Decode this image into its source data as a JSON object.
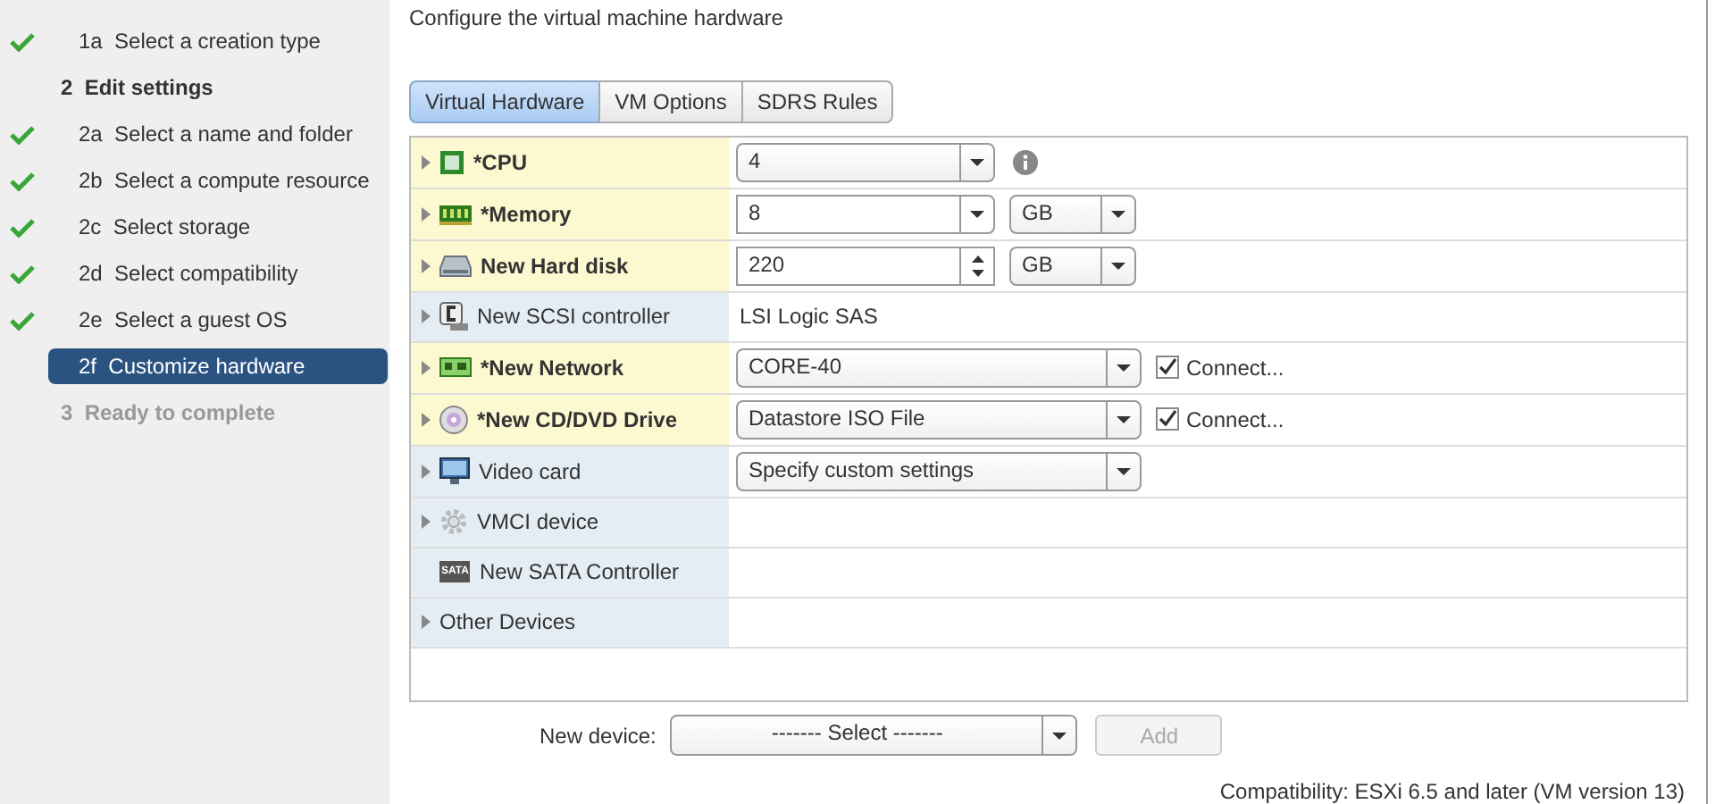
{
  "steps": [
    {
      "number": "1a",
      "label": "Select a creation type",
      "kind": "substep",
      "done": true,
      "selected": false,
      "disabled": false
    },
    {
      "number": "2",
      "label": "Edit settings",
      "kind": "group",
      "done": false,
      "selected": false,
      "disabled": false
    },
    {
      "number": "2a",
      "label": "Select a name and folder",
      "kind": "substep",
      "done": true,
      "selected": false,
      "disabled": false
    },
    {
      "number": "2b",
      "label": "Select a compute resource",
      "kind": "substep",
      "done": true,
      "selected": false,
      "disabled": false
    },
    {
      "number": "2c",
      "label": "Select storage",
      "kind": "substep",
      "done": true,
      "selected": false,
      "disabled": false
    },
    {
      "number": "2d",
      "label": "Select compatibility",
      "kind": "substep",
      "done": true,
      "selected": false,
      "disabled": false
    },
    {
      "number": "2e",
      "label": "Select a guest OS",
      "kind": "substep",
      "done": true,
      "selected": false,
      "disabled": false
    },
    {
      "number": "2f",
      "label": "Customize hardware",
      "kind": "substep",
      "done": false,
      "selected": true,
      "disabled": false
    },
    {
      "number": "3",
      "label": "Ready to complete",
      "kind": "group",
      "done": false,
      "selected": false,
      "disabled": true
    }
  ],
  "heading": "Configure the virtual machine hardware",
  "tabs": [
    {
      "label": "Virtual Hardware",
      "selected": true
    },
    {
      "label": "VM Options",
      "selected": false
    },
    {
      "label": "SDRS Rules",
      "selected": false
    }
  ],
  "devices": [
    {
      "kind": "cpu",
      "name": "*CPU",
      "bold": true,
      "modified": true,
      "expandable": true,
      "control": {
        "kind": "select",
        "value": "4"
      },
      "info": true
    },
    {
      "kind": "memory",
      "name": "*Memory",
      "bold": true,
      "modified": true,
      "expandable": true,
      "control": {
        "kind": "input",
        "value": "8"
      },
      "unit": "GB"
    },
    {
      "kind": "disk",
      "name": "New Hard disk",
      "bold": true,
      "modified": true,
      "expandable": true,
      "control": {
        "kind": "spinner",
        "value": "220"
      },
      "unit": "GB"
    },
    {
      "kind": "scsi",
      "name": "New SCSI controller",
      "bold": false,
      "modified": false,
      "expandable": true,
      "control": {
        "kind": "text",
        "value": "LSI Logic SAS"
      }
    },
    {
      "kind": "network",
      "name": "*New Network",
      "bold": true,
      "modified": true,
      "expandable": true,
      "control": {
        "kind": "select",
        "value": "CORE-40"
      },
      "connect": {
        "label": "Connect...",
        "checked": true
      }
    },
    {
      "kind": "cdrom",
      "name": "*New CD/DVD Drive",
      "bold": true,
      "modified": true,
      "expandable": true,
      "control": {
        "kind": "select",
        "value": "Datastore ISO File"
      },
      "connect": {
        "label": "Connect...",
        "checked": true
      }
    },
    {
      "kind": "video",
      "name": "Video card",
      "bold": false,
      "modified": false,
      "expandable": true,
      "control": {
        "kind": "select",
        "value": "Specify custom settings"
      }
    },
    {
      "kind": "vmci",
      "name": "VMCI device",
      "bold": false,
      "modified": false,
      "expandable": true
    },
    {
      "kind": "sata",
      "name": "New SATA Controller",
      "bold": false,
      "modified": false,
      "expandable": false,
      "icon_text": "SATA"
    },
    {
      "kind": "other",
      "name": "Other Devices",
      "bold": false,
      "modified": false,
      "expandable": true
    }
  ],
  "new_device": {
    "label": "New device:",
    "value": "------- Select -------",
    "button": "Add",
    "button_disabled": true
  },
  "compatibility": "Compatibility: ESXi 6.5 and later (VM version 13)"
}
